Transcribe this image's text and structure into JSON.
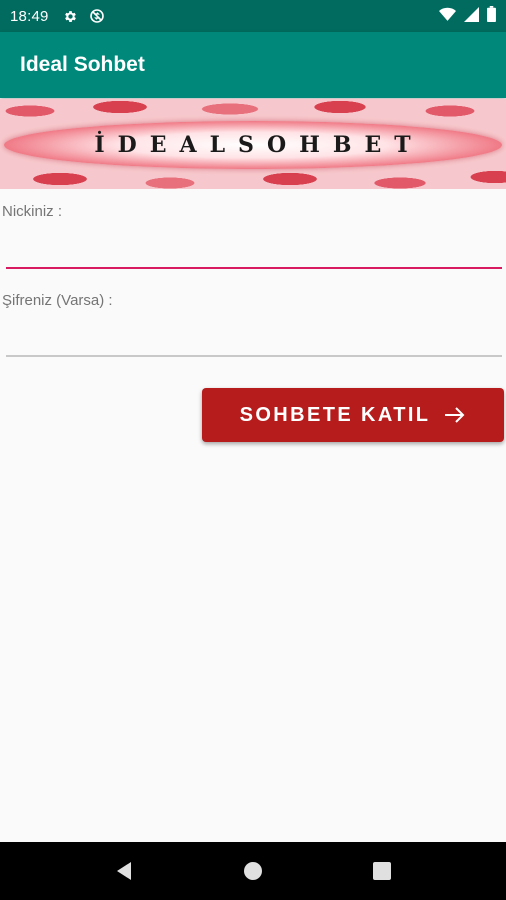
{
  "status_bar": {
    "time": "18:49",
    "left_icons": [
      "settings-icon",
      "sync-off-icon"
    ],
    "right_icons": [
      "wifi-icon",
      "signal-icon",
      "battery-icon"
    ]
  },
  "app_bar": {
    "title": "Ideal Sohbet"
  },
  "banner": {
    "text": "İDEALSOHBET"
  },
  "form": {
    "nick_label": "Nickiniz :",
    "nick_value": "",
    "password_label": "Şifreniz (Varsa) :",
    "password_value": "",
    "join_button_label": "SOHBETE KATIL"
  },
  "nav_bar": {
    "buttons": [
      "back-icon",
      "home-icon",
      "recents-icon"
    ]
  },
  "colors": {
    "status_bar": "#006b5e",
    "app_bar": "#00897b",
    "accent_underline": "#d81b60",
    "button": "#b71c1c",
    "background": "#fafafa"
  }
}
